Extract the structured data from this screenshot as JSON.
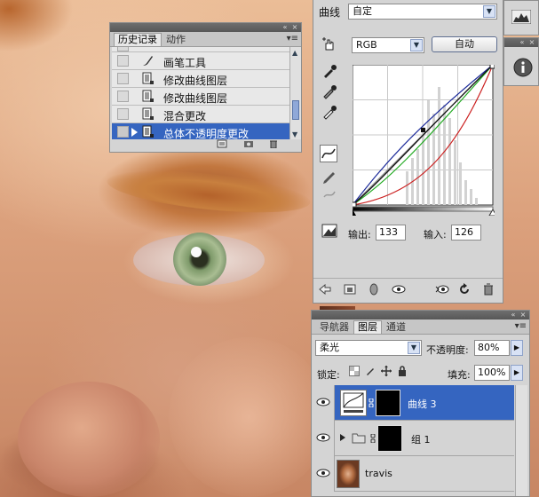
{
  "history": {
    "tabs": [
      "历史记录",
      "动作"
    ],
    "items": [
      {
        "label": "画笔工具"
      },
      {
        "label": "修改曲线图层"
      },
      {
        "label": "修改曲线图层"
      },
      {
        "label": "混合更改"
      },
      {
        "label": "总体不透明度更改",
        "selected": true
      }
    ]
  },
  "curves": {
    "title": "曲线",
    "preset": "自定",
    "channel": "RGB",
    "auto_label": "自动",
    "output_label": "输出:",
    "output_value": "133",
    "input_label": "输入:",
    "input_value": "126"
  },
  "layers": {
    "tabs": [
      "导航器",
      "图层",
      "通道"
    ],
    "blend_mode": "柔光",
    "opacity_label": "不透明度:",
    "opacity_value": "80%",
    "lock_label": "锁定:",
    "fill_label": "填充:",
    "fill_value": "100%",
    "rows": [
      {
        "name": "曲线 3",
        "type": "adjustment",
        "selected": true
      },
      {
        "name": "组 1",
        "type": "group"
      },
      {
        "name": "travis",
        "type": "image"
      }
    ]
  },
  "colors": {
    "selection": "#3565c0",
    "panel": "#d4d4d4",
    "titlebar": "#5f5f5f"
  }
}
